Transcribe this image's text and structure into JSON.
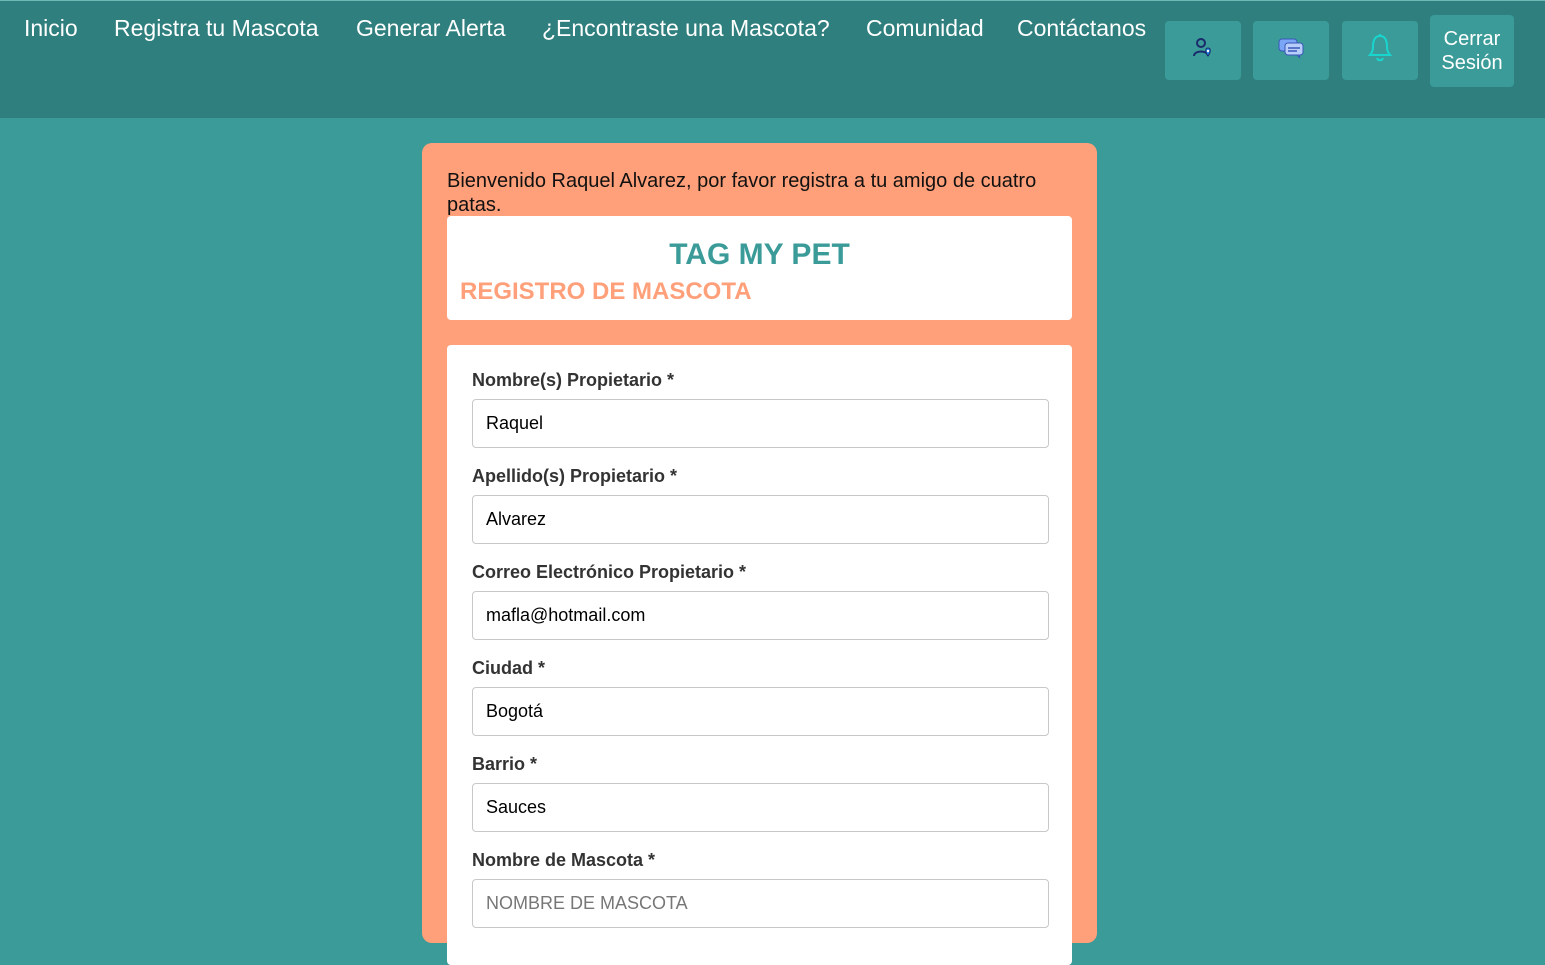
{
  "nav": {
    "links": [
      {
        "label": "Inicio"
      },
      {
        "label": "Registra tu Mascota"
      },
      {
        "label": "Generar Alerta"
      },
      {
        "label": "¿Encontraste una Mascota?"
      },
      {
        "label": "Comunidad"
      },
      {
        "label": "Contáctanos"
      }
    ],
    "icons": [
      "location-user-icon",
      "chat-icon",
      "bell-icon"
    ],
    "logout": {
      "line1": "Cerrar",
      "line2": "Sesión"
    }
  },
  "colors": {
    "header": "#2f7f7e",
    "background": "#3a9b98",
    "card": "#ffa07a",
    "brand": "#3a9b98",
    "subtitle": "#ffa07a"
  },
  "card": {
    "welcome": "Bienvenido Raquel Alvarez, por favor registra a tu amigo de cuatro patas.",
    "brand_title": "TAG MY PET",
    "subtitle": "REGISTRO DE MASCOTA"
  },
  "form": {
    "fields": [
      {
        "label": "Nombre(s) Propietario *",
        "value": "Raquel",
        "placeholder": ""
      },
      {
        "label": "Apellido(s) Propietario *",
        "value": "Alvarez",
        "placeholder": ""
      },
      {
        "label": "Correo Electrónico Propietario *",
        "value": "mafla@hotmail.com",
        "placeholder": ""
      },
      {
        "label": "Ciudad *",
        "value": "Bogotá",
        "placeholder": ""
      },
      {
        "label": "Barrio *",
        "value": "Sauces",
        "placeholder": ""
      },
      {
        "label": "Nombre de Mascota *",
        "value": "",
        "placeholder": "NOMBRE DE MASCOTA"
      }
    ]
  }
}
